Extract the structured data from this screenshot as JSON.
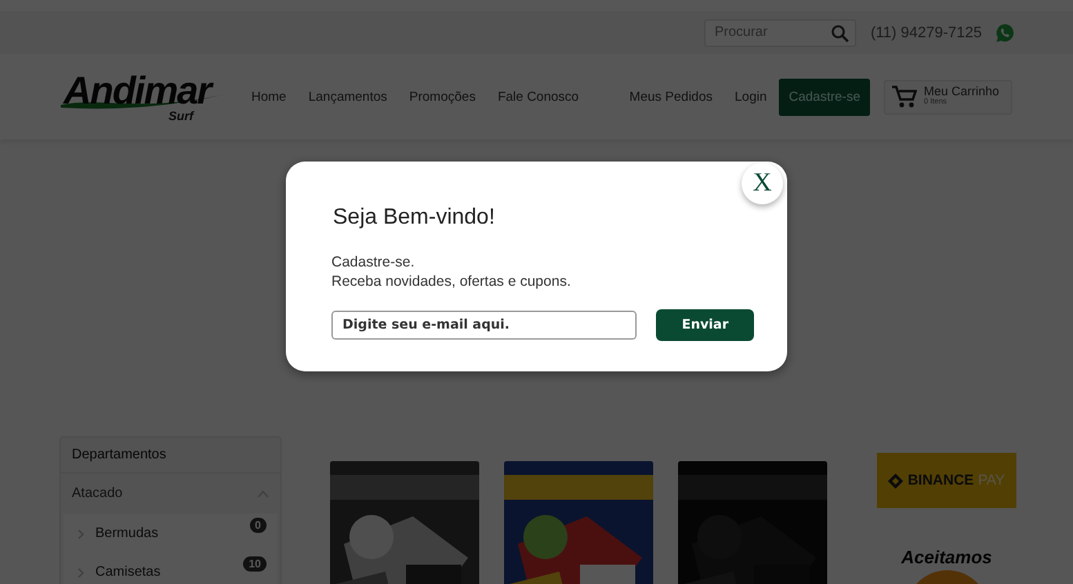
{
  "top_bar": {
    "search": {
      "placeholder": "Procurar"
    },
    "phone": "(11) 94279-7125"
  },
  "header": {
    "logo": {
      "name": "Andimar",
      "tagline": "Surf"
    },
    "nav": [
      "Home",
      "Lançamentos",
      "Promoções",
      "Fale Conosco"
    ],
    "account_links": [
      "Meus Pedidos",
      "Login"
    ],
    "signup_button": "Cadastre-se",
    "cart": {
      "label": "Meu Carrinho",
      "count": "0 Itens"
    }
  },
  "sidebar": {
    "title": "Departamentos",
    "groups": [
      {
        "label": "Atacado",
        "expanded": true,
        "children": [
          {
            "label": "Bermudas",
            "count": "0"
          },
          {
            "label": "Camisetas",
            "count": "10"
          }
        ]
      }
    ]
  },
  "payment": {
    "banner": {
      "name": "BINANCE",
      "suffix": "PAY"
    },
    "note": "Aceitamos"
  },
  "modal": {
    "title": "Seja Bem-vindo!",
    "lines": [
      "Cadastre-se.",
      "Receba novidades, ofertas e cupons."
    ],
    "email": {
      "placeholder": "Digite seu e-mail aqui."
    },
    "submit": "Enviar",
    "close": "X"
  }
}
